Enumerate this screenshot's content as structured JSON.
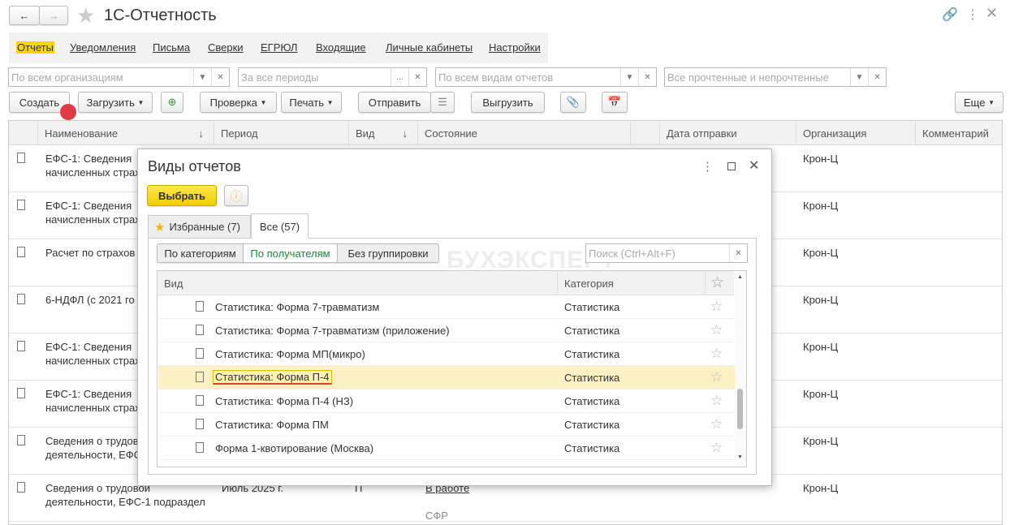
{
  "window": {
    "title": "1С-Отчетность"
  },
  "nav": [
    {
      "label": "Отчеты",
      "active": true
    },
    {
      "label": "Уведомления"
    },
    {
      "label": "Письма"
    },
    {
      "label": "Сверки"
    },
    {
      "label": "ЕГРЮЛ"
    },
    {
      "label": "Входящие"
    },
    {
      "label": "Личные кабинеты"
    },
    {
      "label": "Настройки"
    }
  ],
  "filters": {
    "org": "По всем организациям",
    "period": "За все периоды",
    "kind": "По всем видам отчетов",
    "read": "Все прочтенные и непрочтенные"
  },
  "toolbar": {
    "create": "Создать",
    "load": "Загрузить",
    "check": "Проверка",
    "print": "Печать",
    "send": "Отправить",
    "export": "Выгрузить",
    "more": "Еще"
  },
  "columns": [
    "Наименование",
    "Период",
    "Вид",
    "Состояние",
    "Дата отправки",
    "Организация",
    "Комментарий"
  ],
  "rows": [
    {
      "name1": "ЕФС-1: Сведения",
      "name2": "начисленных страх",
      "org": "Крон-Ц"
    },
    {
      "name1": "ЕФС-1: Сведения",
      "name2": "начисленных страх",
      "org": "Крон-Ц"
    },
    {
      "name1": "Расчет по страхов",
      "name2": "",
      "org": "Крон-Ц"
    },
    {
      "name1": "6-НДФЛ (с 2021 го",
      "name2": "",
      "org": "Крон-Ц"
    },
    {
      "name1": "ЕФС-1: Сведения",
      "name2": "начисленных страх",
      "org": "Крон-Ц"
    },
    {
      "name1": "ЕФС-1: Сведения",
      "name2": "начисленных страх",
      "org": "Крон-Ц"
    },
    {
      "name1": "Сведения о трудов",
      "name2": "деятельности, ЕФС",
      "org": "Крон-Ц"
    },
    {
      "name1": "Сведения о трудовой",
      "name2": "деятельности, ЕФС-1 подраздел",
      "period": "Июль 2025 г.",
      "kind": "П",
      "status": "В работе",
      "recipient": "СФР",
      "org": "Крон-Ц"
    }
  ],
  "dialog": {
    "title": "Виды отчетов",
    "select": "Выбрать",
    "tabs": [
      {
        "label": "Избранные (7)"
      },
      {
        "label": "Все (57)",
        "active": true
      }
    ],
    "groupings": [
      {
        "label": "По категориям"
      },
      {
        "label": "По получателям",
        "active": true
      },
      {
        "label": "Без группировки"
      }
    ],
    "search_placeholder": "Поиск (Ctrl+Alt+F)",
    "col_kind": "Вид",
    "col_category": "Категория",
    "items": [
      {
        "name": "Статистика: Форма 7-травматизм",
        "category": "Статистика"
      },
      {
        "name": "Статистика: Форма 7-травматизм (приложение)",
        "category": "Статистика"
      },
      {
        "name": "Статистика: Форма МП(микро)",
        "category": "Статистика"
      },
      {
        "name": "Статистика: Форма П-4",
        "category": "Статистика",
        "selected": true
      },
      {
        "name": "Статистика: Форма П-4 (НЗ)",
        "category": "Статистика"
      },
      {
        "name": "Статистика: Форма ПМ",
        "category": "Статистика"
      },
      {
        "name": "Форма 1-квотирование (Москва)",
        "category": "Статистика"
      }
    ]
  },
  "watermark": "БУХЭКСПЕРТ",
  "colors": {
    "accent": "#f5d800",
    "selected_row": "#fbf1c4",
    "highlight_underline": "#e0402a",
    "active_grouping": "#1a8a3a"
  }
}
